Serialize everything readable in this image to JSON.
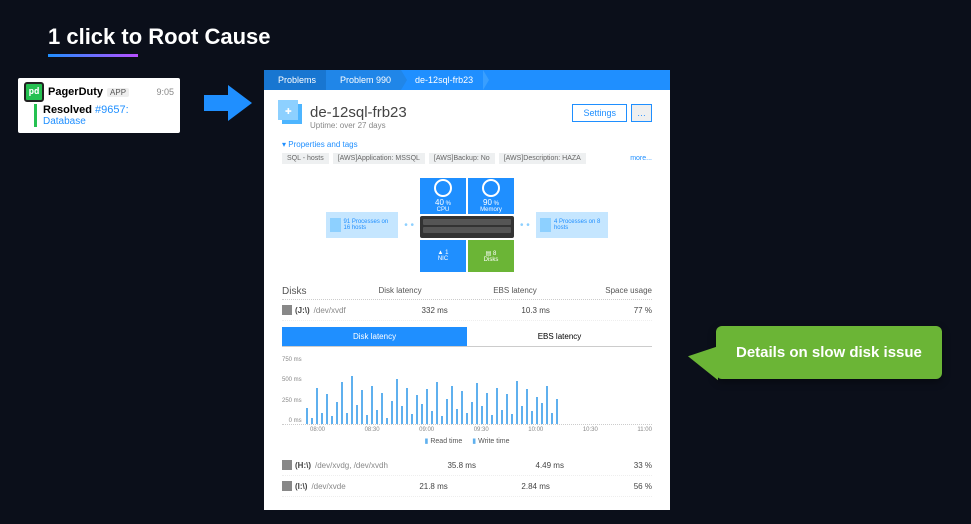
{
  "slide": {
    "title": "1 click to Root Cause"
  },
  "pagerduty": {
    "app_name": "PagerDuty",
    "app_badge": "APP",
    "time": "9:05",
    "status": "Resolved",
    "ticket": "#9657:",
    "service": "Database",
    "logo_text": "pd"
  },
  "breadcrumb": {
    "items": [
      "Problems",
      "Problem 990",
      "de-12sql-frb23"
    ]
  },
  "host": {
    "name": "de-12sql-frb23",
    "uptime": "Uptime: over 27 days",
    "settings_label": "Settings",
    "dots_label": "…",
    "properties_toggle": "▾ Properties and tags",
    "tags": [
      "SQL - hosts",
      "[AWS]Application: MSSQL",
      "[AWS]Backup: No",
      "[AWS]Description: HAZA"
    ],
    "more": "more..."
  },
  "topology": {
    "left_box": "91 Processes on 16 hosts",
    "right_box": "4 Processes on 8 hosts",
    "cpu": {
      "value": "40",
      "unit": "%",
      "label": "CPU"
    },
    "memory": {
      "value": "90",
      "unit": "%",
      "label": "Memory"
    },
    "nic": {
      "count": "1",
      "label": "NIC"
    },
    "disks": {
      "count": "8",
      "label": "Disks"
    }
  },
  "disks_section": {
    "title": "Disks",
    "columns": [
      "Disk latency",
      "EBS latency",
      "Space usage"
    ],
    "rows": [
      {
        "letter": "(J:\\)",
        "path": "/dev/xvdf",
        "disk_latency": "332 ms",
        "ebs_latency": "10.3 ms",
        "space": "77 %"
      },
      {
        "letter": "(H:\\)",
        "path": "/dev/xvdg, /dev/xvdh",
        "disk_latency": "35.8 ms",
        "ebs_latency": "4.49 ms",
        "space": "33 %"
      },
      {
        "letter": "(I:\\)",
        "path": "/dev/xvde",
        "disk_latency": "21.8 ms",
        "ebs_latency": "2.84 ms",
        "space": "56 %"
      }
    ]
  },
  "tabs": {
    "disk_latency": "Disk latency",
    "ebs_latency": "EBS latency"
  },
  "chart_data": {
    "type": "bar",
    "title": "Disk latency",
    "ylabel": "ms",
    "ylim": [
      0,
      750
    ],
    "y_ticks": [
      "750 ms",
      "500 ms",
      "250 ms",
      "0 ms"
    ],
    "x_ticks": [
      "08:00",
      "08:30",
      "09:00",
      "09:30",
      "10:00",
      "10:30",
      "11:00"
    ],
    "series": [
      {
        "name": "Read time",
        "values": [
          120,
          40,
          300,
          80,
          250,
          60,
          180,
          350,
          90,
          400,
          150,
          280,
          70,
          320,
          110,
          260,
          50,
          190,
          370,
          140,
          300,
          80,
          240,
          160,
          290,
          100,
          350,
          60,
          200,
          310,
          120,
          270,
          90,
          180,
          340,
          150,
          260,
          70,
          300,
          110,
          250,
          80,
          360,
          140,
          290,
          100,
          220,
          170,
          310,
          90,
          200
        ]
      },
      {
        "name": "Write time",
        "values": [
          80,
          30,
          150,
          60,
          130,
          40,
          100,
          180,
          50,
          200,
          90,
          140,
          40,
          160,
          70,
          130,
          30,
          100,
          190,
          80,
          150,
          50,
          120,
          90,
          150,
          60,
          180,
          40,
          110,
          160,
          70,
          140,
          50,
          100,
          170,
          80,
          130,
          40,
          150,
          60,
          130,
          50,
          180,
          80,
          150,
          60,
          120,
          90,
          160,
          50,
          110
        ]
      }
    ],
    "legend": [
      "Read time",
      "Write time"
    ]
  },
  "callout": {
    "text": "Details on slow disk issue"
  }
}
